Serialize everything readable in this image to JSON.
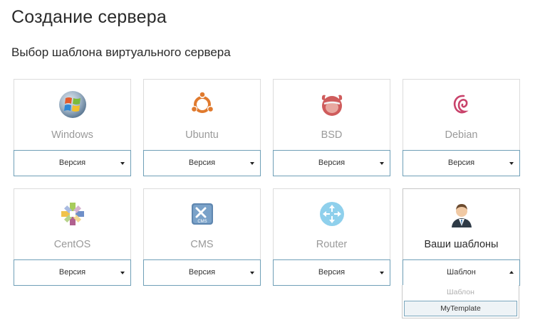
{
  "page": {
    "title": "Создание сервера",
    "section_title": "Выбор шаблона виртуального сервера"
  },
  "cards": [
    {
      "name": "Windows",
      "select_label": "Версия",
      "icon": "windows-icon"
    },
    {
      "name": "Ubuntu",
      "select_label": "Версия",
      "icon": "ubuntu-icon"
    },
    {
      "name": "BSD",
      "select_label": "Версия",
      "icon": "bsd-icon"
    },
    {
      "name": "Debian",
      "select_label": "Версия",
      "icon": "debian-icon"
    },
    {
      "name": "CentOS",
      "select_label": "Версия",
      "icon": "centos-icon"
    },
    {
      "name": "CMS",
      "select_label": "Версия",
      "icon": "cms-icon"
    },
    {
      "name": "Router",
      "select_label": "Версия",
      "icon": "router-icon"
    },
    {
      "name": "Ваши шаблоны",
      "select_label": "Шаблон",
      "icon": "user-icon",
      "expanded": true
    }
  ],
  "dropdown": {
    "header": "Шаблон",
    "options": [
      "MyTemplate"
    ]
  },
  "colors": {
    "select_border": "#6f9fb7",
    "card_border": "#dcdcdc",
    "muted_text": "#9a9a9a",
    "option_highlight": "#eef3f6"
  }
}
